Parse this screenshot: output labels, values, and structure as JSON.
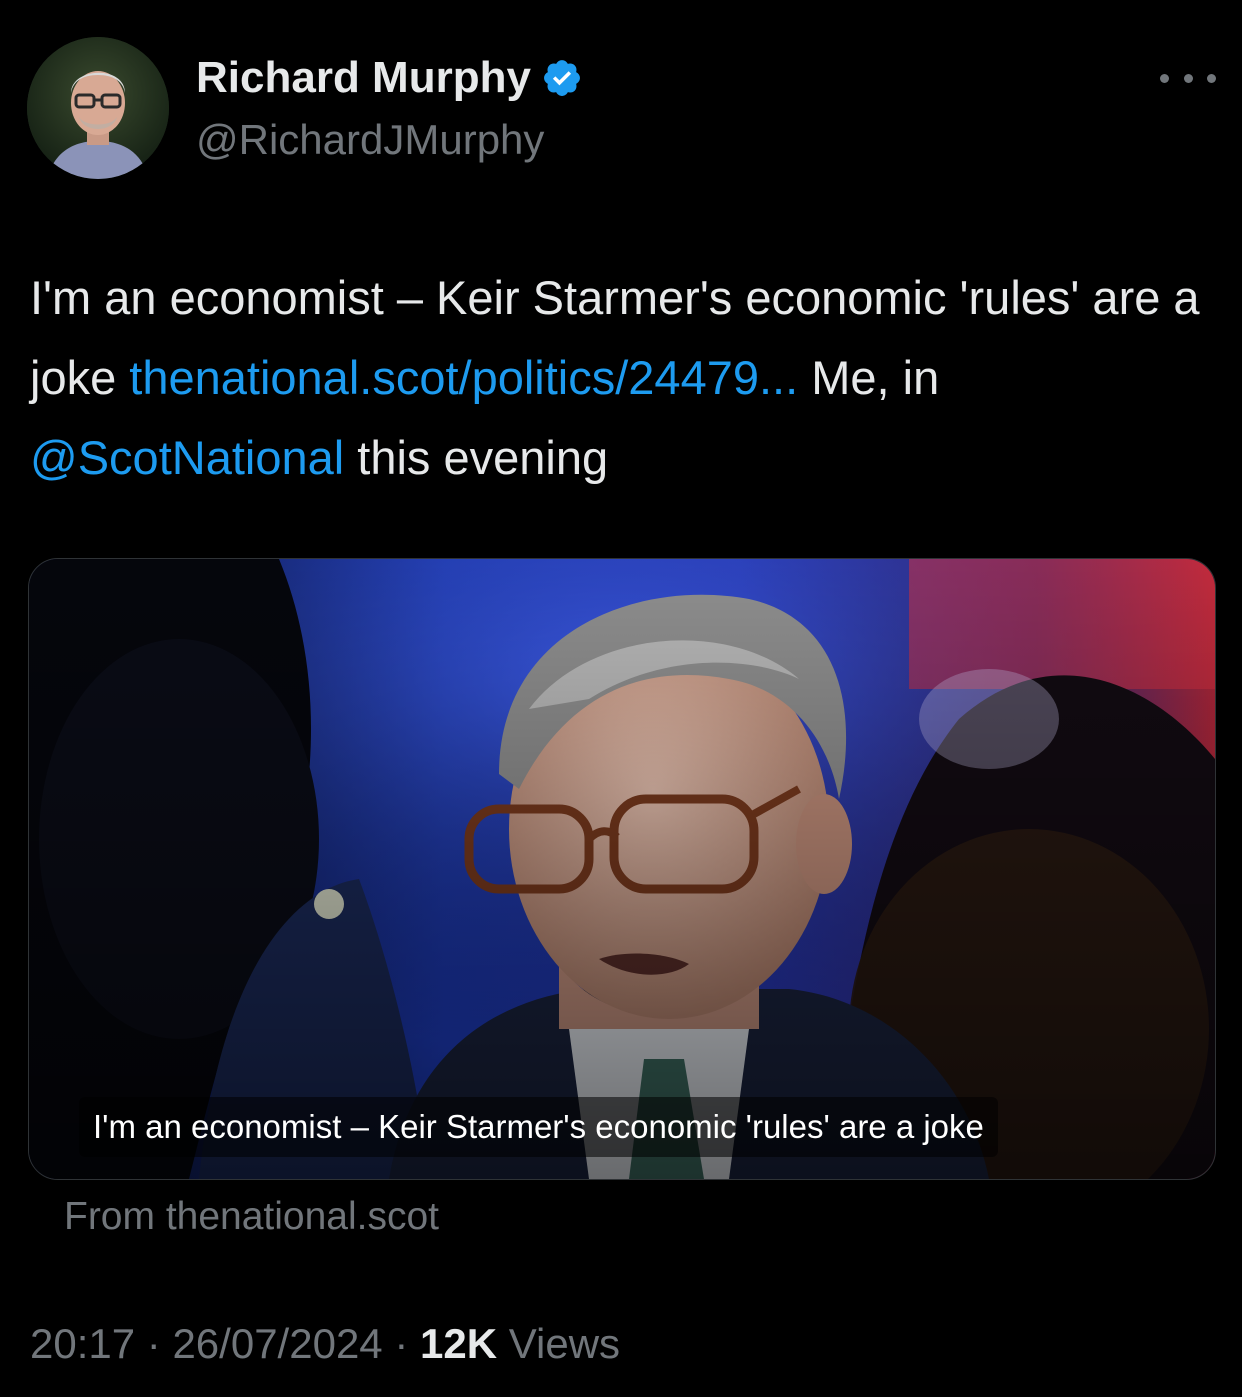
{
  "author": {
    "name": "Richard Murphy",
    "handle": "@RichardJMurphy",
    "verified": true,
    "avatar_icon": "profile-photo"
  },
  "more_icon": "more-horizontal-icon",
  "tweet": {
    "text_part1": "I'm an economist – Keir Starmer's economic 'rules' are a joke ",
    "link_url": "thenational.scot/politics/24479...",
    "text_part2": " Me, in ",
    "mention": "@ScotNational",
    "text_part3": " this evening"
  },
  "card": {
    "image_caption": "I'm an economist – Keir Starmer's economic 'rules' are a joke",
    "source": "From thenational.scot"
  },
  "meta": {
    "time": "20:17",
    "separator": "·",
    "date": "26/07/2024",
    "views_count": "12K",
    "views_label": "Views"
  },
  "colors": {
    "background": "#000000",
    "primary_text": "#e7e9ea",
    "secondary_text": "#71767b",
    "link": "#1d9bf0",
    "verified_badge": "#1d9bf0"
  }
}
